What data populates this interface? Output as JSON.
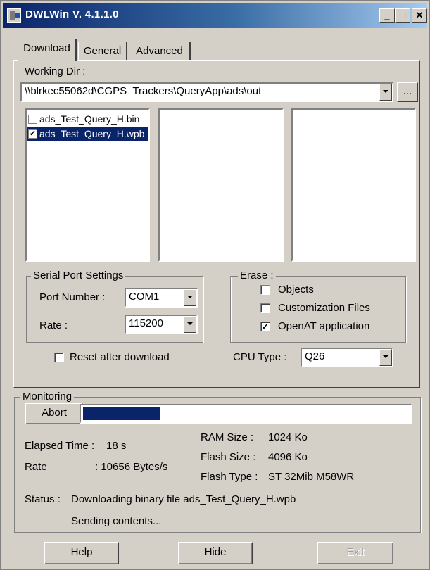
{
  "window": {
    "title": "DWLWin V. 4.1.1.0"
  },
  "tabs": [
    {
      "label": "Download",
      "active": true
    },
    {
      "label": "General",
      "active": false
    },
    {
      "label": "Advanced",
      "active": false
    }
  ],
  "download": {
    "working_dir_label": "Working Dir :",
    "working_dir_value": "\\\\blrkec55062d\\CGPS_Trackers\\QueryApp\\ads\\out",
    "browse_label": "...",
    "files": [
      {
        "name": "ads_Test_Query_H.bin",
        "checked": false,
        "selected": false
      },
      {
        "name": "ads_Test_Query_H.wpb",
        "checked": true,
        "selected": true
      }
    ],
    "serial": {
      "legend": "Serial Port Settings",
      "port_label": "Port Number :",
      "port_value": "COM1",
      "rate_label": "Rate :",
      "rate_value": "115200"
    },
    "reset_label": "Reset after download",
    "erase": {
      "legend": "Erase :",
      "items": [
        {
          "label": "Objects",
          "checked": false
        },
        {
          "label": "Customization Files",
          "checked": false
        },
        {
          "label": "OpenAT application",
          "checked": true
        }
      ]
    },
    "cpu_label": "CPU Type :",
    "cpu_value": "Q26"
  },
  "monitoring": {
    "legend": "Monitoring",
    "abort_label": "Abort",
    "progress": 0.24,
    "elapsed_label": "Elapsed Time :",
    "elapsed_value": "18 s",
    "rate_label": "Rate",
    "rate_value": ": 10656 Bytes/s",
    "ram_label": "RAM Size :",
    "ram_value": "1024 Ko",
    "flash_size_label": "Flash Size :",
    "flash_size_value": "4096 Ko",
    "flash_type_label": "Flash Type :",
    "flash_type_value": "ST 32Mib M58WR",
    "status_label": "Status :",
    "status_line1": "Downloading binary file ads_Test_Query_H.wpb",
    "status_line2": "Sending contents..."
  },
  "buttons": {
    "help": "Help",
    "hide": "Hide",
    "exit": "Exit"
  }
}
